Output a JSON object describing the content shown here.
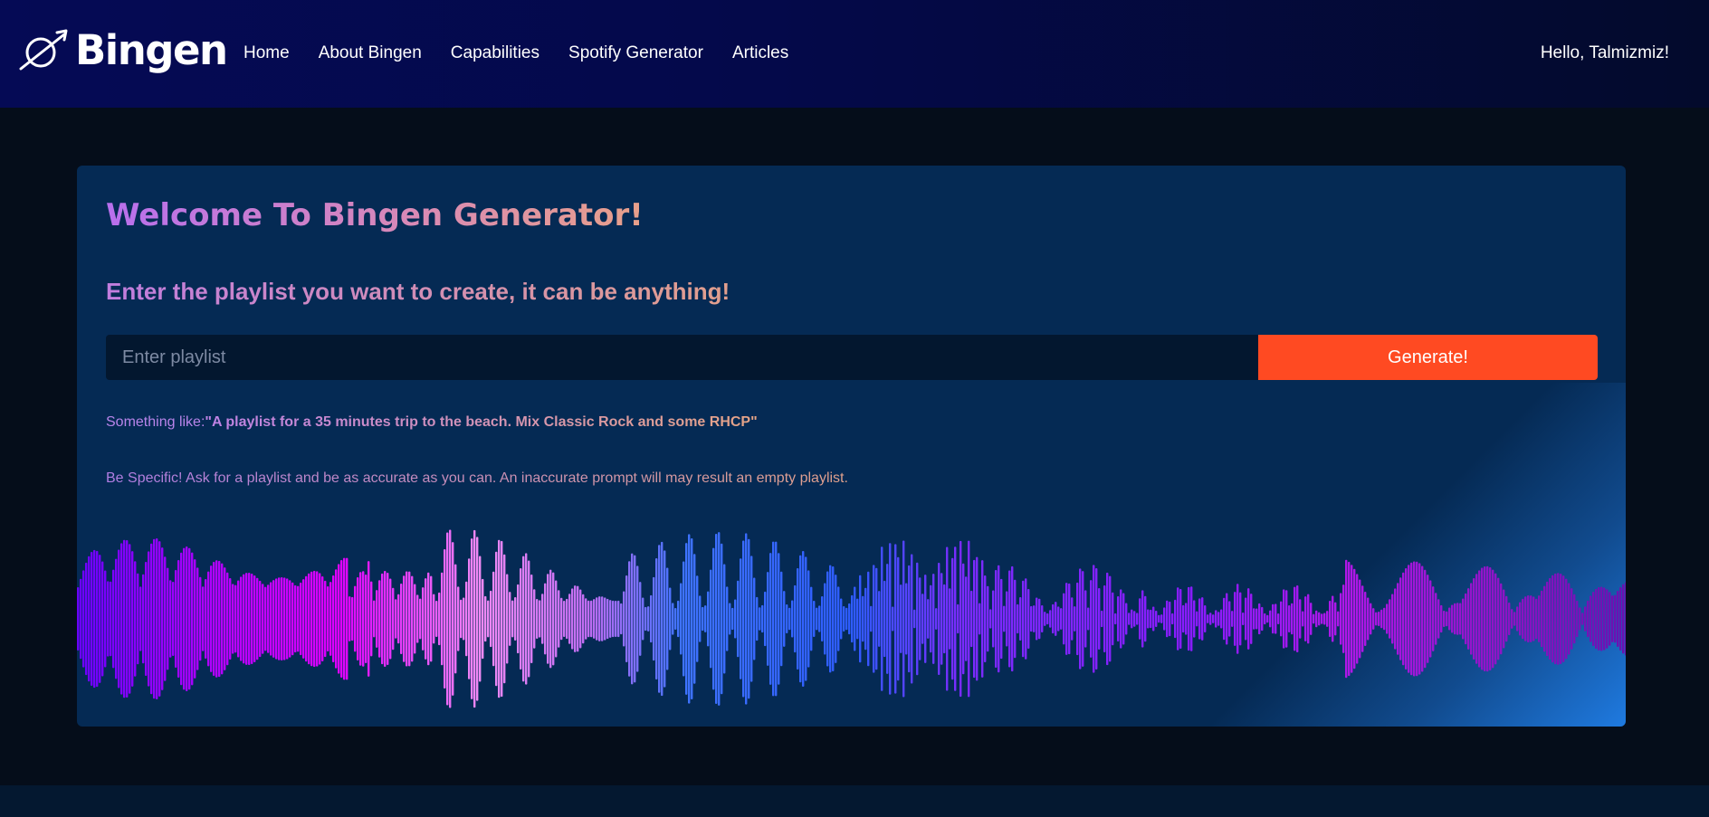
{
  "brand": {
    "name": "Bingen",
    "logo_icon": "planet-comet-icon"
  },
  "nav": {
    "items": [
      {
        "label": "Home"
      },
      {
        "label": "About Bingen"
      },
      {
        "label": "Capabilities"
      },
      {
        "label": "Spotify Generator"
      },
      {
        "label": "Articles"
      }
    ],
    "greeting": "Hello, Talmizmiz!"
  },
  "main": {
    "title": "Welcome To Bingen Generator!",
    "subtitle": "Enter the playlist you want to create, it can be anything!",
    "input": {
      "placeholder": "Enter playlist",
      "value": ""
    },
    "generate_label": "Generate!",
    "example_prefix": "Something like:",
    "example_text": "\"A playlist for a 35 minutes trip to the beach. Mix Classic Rock and some RHCP\"",
    "hint": "Be Specific! Ask for a playlist and be as accurate as you can. An inaccurate prompt will may result an empty playlist.",
    "waveform_image": "audio-waveform-graphic"
  },
  "colors": {
    "nav_bg": "#04094a",
    "page_bg": "#050d1a",
    "card_bg": "#052a54",
    "button_bg": "#ff4a22",
    "title_gradient_start": "#b86fee",
    "title_gradient_end": "#e8a08a",
    "wave_purple": "#7a00ff",
    "wave_magenta": "#d400ff",
    "wave_blue": "#2f6bff"
  }
}
